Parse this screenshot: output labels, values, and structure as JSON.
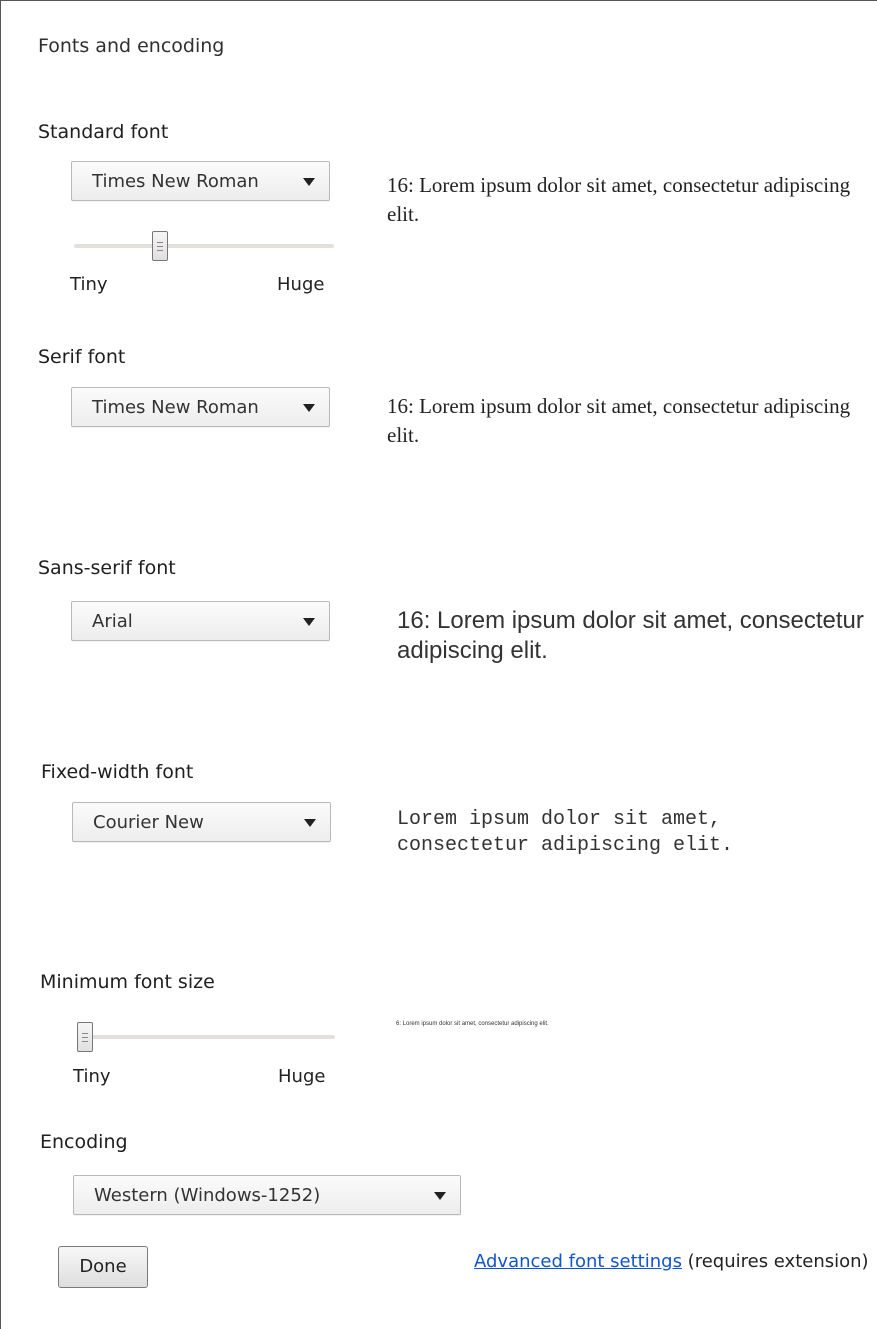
{
  "title": "Fonts and encoding",
  "standard": {
    "label": "Standard font",
    "selected": "Times New Roman",
    "preview": "16: Lorem ipsum dolor sit amet, consectetur adipiscing elit.",
    "slider": {
      "min_label": "Tiny",
      "max_label": "Huge",
      "level_fraction": 0.32
    }
  },
  "serif": {
    "label": "Serif font",
    "selected": "Times New Roman",
    "preview": "16: Lorem ipsum dolor sit amet, consectetur adipiscing elit."
  },
  "sans": {
    "label": "Sans-serif font",
    "selected": "Arial",
    "preview": "16: Lorem ipsum dolor sit amet, consectetur adipiscing elit."
  },
  "fixed": {
    "label": "Fixed-width font",
    "selected": "Courier New",
    "preview": "Lorem ipsum dolor sit amet, consectetur adipiscing elit."
  },
  "minimum": {
    "label": "Minimum font size",
    "preview": "6: Lorem ipsum dolor sit amet, consectetur adipiscing elit.",
    "slider": {
      "min_label": "Tiny",
      "max_label": "Huge",
      "level_fraction": 0.0
    }
  },
  "encoding": {
    "label": "Encoding",
    "selected": "Western (Windows-1252)"
  },
  "footer": {
    "done_label": "Done",
    "advanced_link": "Advanced font settings",
    "advanced_suffix": " (requires extension)"
  },
  "colors": {
    "link": "#1155cc",
    "track": "#e4dfdb"
  }
}
